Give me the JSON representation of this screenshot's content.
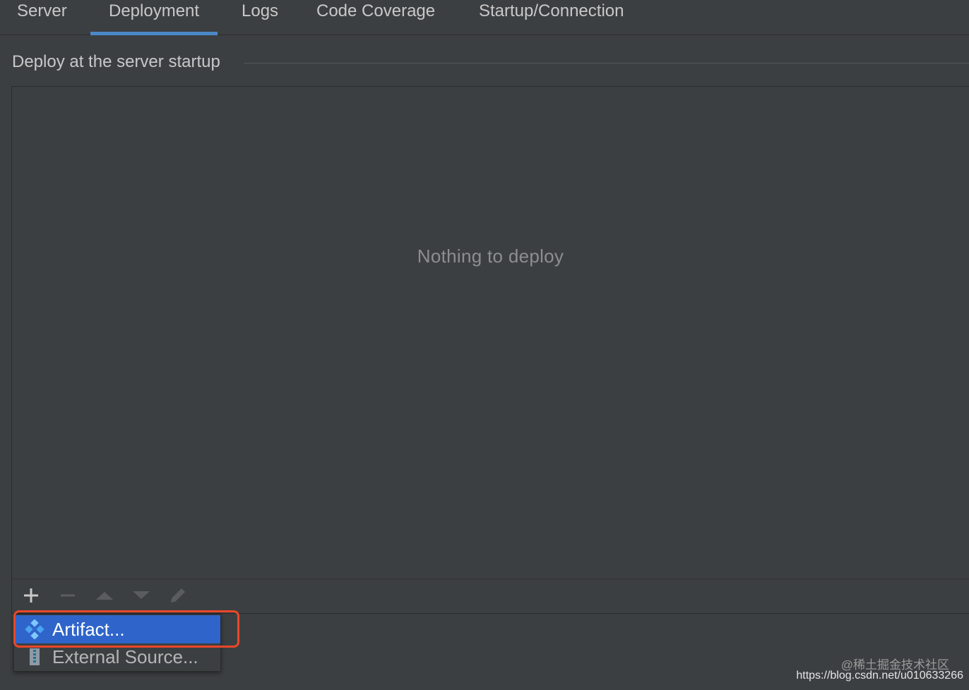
{
  "tabs": [
    {
      "label": "Server",
      "active": false
    },
    {
      "label": "Deployment",
      "active": true
    },
    {
      "label": "Logs",
      "active": false
    },
    {
      "label": "Code Coverage",
      "active": false
    },
    {
      "label": "Startup/Connection",
      "active": false
    }
  ],
  "section": {
    "title": "Deploy at the server startup"
  },
  "deploy_list": {
    "empty_text": "Nothing to deploy"
  },
  "toolbar": {
    "icons": [
      "add-icon",
      "remove-icon",
      "move-up-icon",
      "move-down-icon",
      "edit-icon"
    ]
  },
  "popup_menu": {
    "items": [
      {
        "label": "Artifact...",
        "icon": "artifact-icon",
        "selected": true
      },
      {
        "label": "External Source...",
        "icon": "archive-icon",
        "selected": false
      }
    ]
  },
  "watermark": {
    "line1": "@稀土掘金技术社区",
    "line2": "https://blog.csdn.net/u010633266"
  },
  "colors": {
    "background": "#3c3f41",
    "accent_tab": "#4a88c7",
    "selection": "#2f65ca",
    "highlight_box": "#e8472b"
  }
}
